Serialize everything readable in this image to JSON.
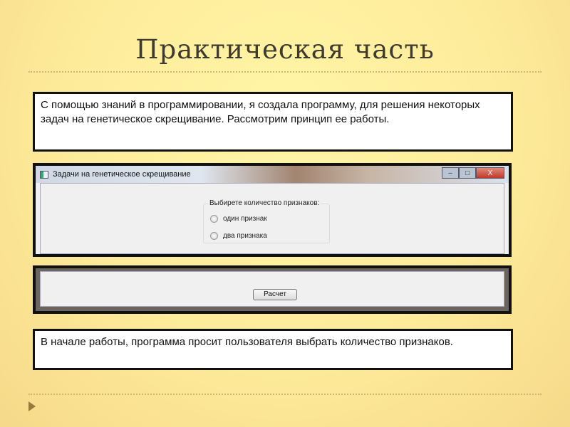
{
  "slide": {
    "title": "Практическая часть",
    "intro": "С помощью знаний в программировании, я создала программу, для решения некоторых задач на генетическое скрещивание. Рассмотрим принцип ее работы.",
    "note": " В начале работы, программа просит пользователя выбрать количество признаков."
  },
  "window": {
    "title": "Задачи на генетическое скрещивание",
    "minimize": "–",
    "maximize": "□",
    "close": "X",
    "group_label": "Выбирете количество признаков:",
    "options": [
      "один признак",
      "два признака"
    ],
    "calc_button": "Расчет"
  }
}
